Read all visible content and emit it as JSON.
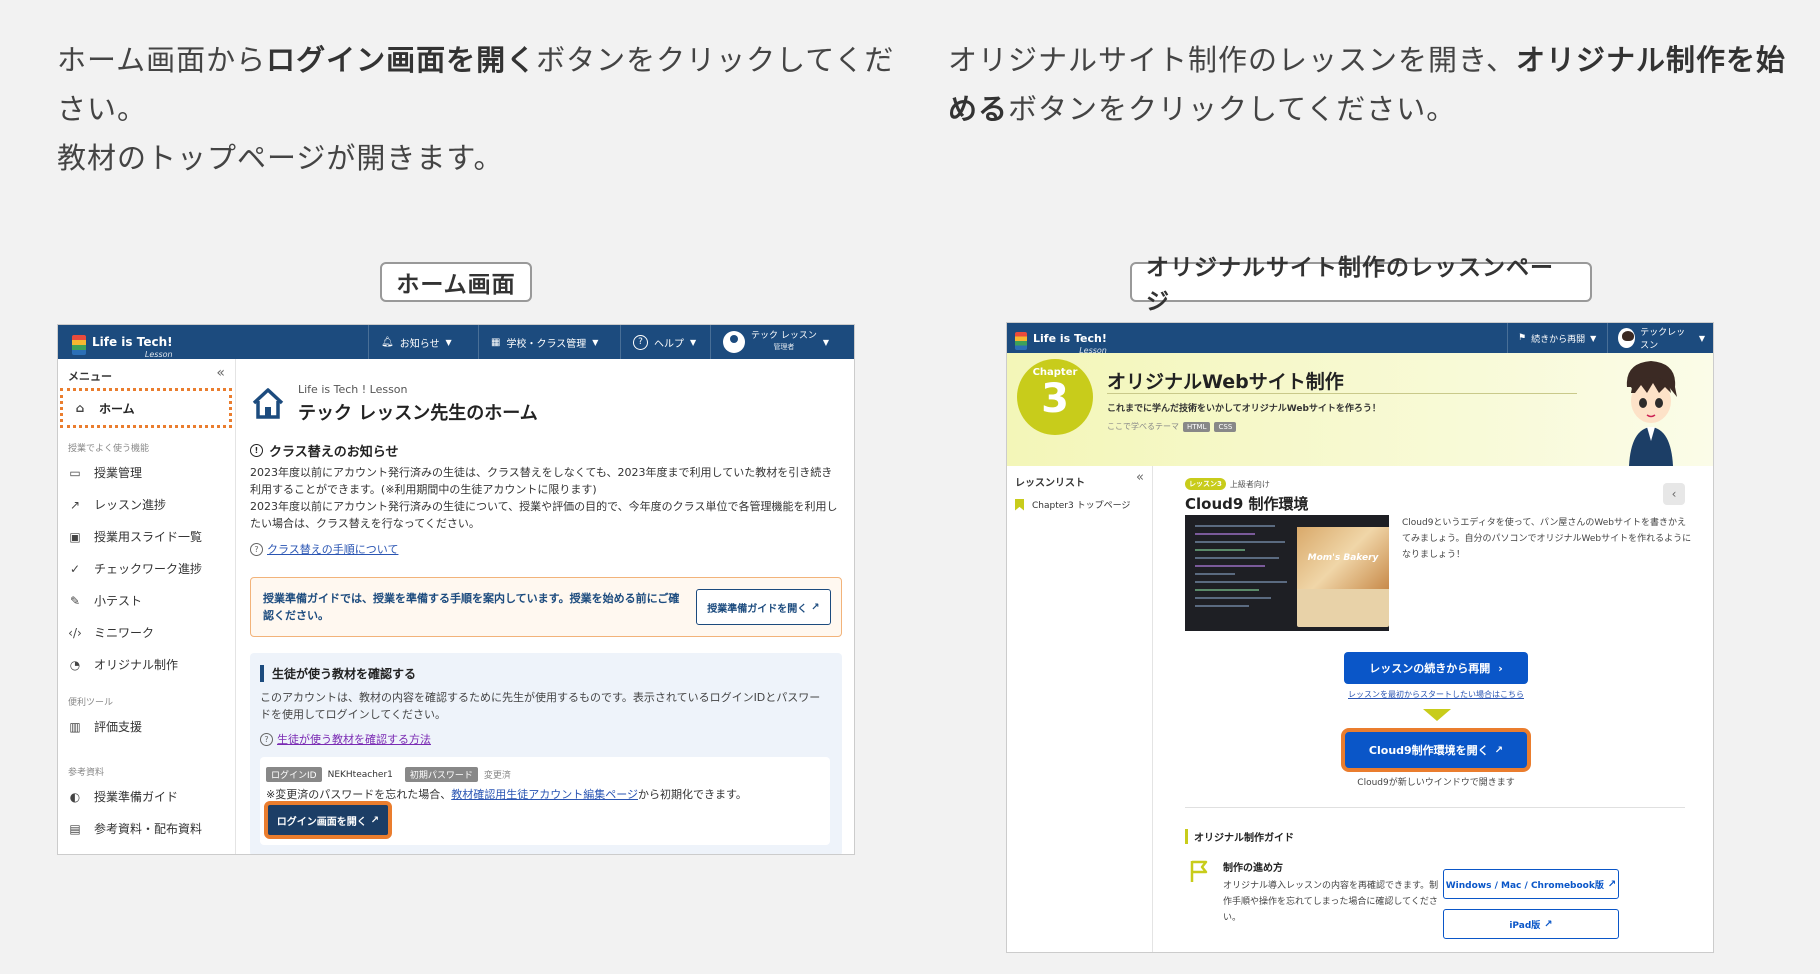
{
  "instructions": {
    "left": {
      "p1_pre": "ホーム画面から",
      "p1_bold": "ログイン画面を開く",
      "p1_post": "ボタンをクリックしてください。",
      "p2": "教材のトップページが開きます。"
    },
    "right": {
      "pre": "オリジナルサイト制作のレッスンを開き、",
      "bold": "オリジナル制作を始める",
      "post": "ボタンをクリックしてください。"
    }
  },
  "captions": {
    "left": "ホーム画面",
    "right": "オリジナルサイト制作のレッスンページ"
  },
  "colors": {
    "navy": "#1c4b7e",
    "orange_highlight": "#ea7d2e",
    "blue_button": "#0a56c8",
    "chapter_green": "#c8cc1b"
  },
  "home_screen": {
    "logo": {
      "text": "Life is Tech!",
      "sub": "Lesson"
    },
    "topbar": {
      "notifications": "お知らせ",
      "school_class": "学校・クラス管理",
      "help": "ヘルプ",
      "user_name": "テック レッスン",
      "user_role": "管理者"
    },
    "sidebar": {
      "menu_label": "メニュー",
      "home": "ホーム",
      "section_frequent": "授業でよく使う機能",
      "items_frequent": [
        {
          "label": "授業管理",
          "icon": "presentation-icon"
        },
        {
          "label": "レッスン進捗",
          "icon": "trend-icon"
        },
        {
          "label": "授業用スライド一覧",
          "icon": "monitor-icon"
        },
        {
          "label": "チェックワーク進捗",
          "icon": "check-circle-icon"
        },
        {
          "label": "小テスト",
          "icon": "pen-icon"
        },
        {
          "label": "ミニワーク",
          "icon": "code-icon"
        },
        {
          "label": "オリジナル制作",
          "icon": "palette-icon"
        }
      ],
      "section_tools": "便利ツール",
      "items_tools": [
        {
          "label": "評価支援",
          "icon": "chart-icon"
        }
      ],
      "section_refs": "参考資料",
      "items_refs": [
        {
          "label": "授業準備ガイド",
          "icon": "shield-icon"
        },
        {
          "label": "参考資料・配布資料",
          "icon": "document-icon"
        }
      ]
    },
    "main": {
      "subtitle": "Life is Tech ! Lesson",
      "title": "テック レッスン先生のホーム",
      "notice_title": "クラス替えのお知らせ",
      "notice_body_1": "2023年度以前にアカウント発行済みの生徒は、クラス替えをしなくても、2023年度まで利用していた教材を引き続き利用することができます。(※利用期間中の生徒アカウントに限ります)",
      "notice_body_2": "2023年度以前にアカウント発行済みの生徒について、授業や評価の目的で、今年度のクラス単位で各管理機能を利用したい場合は、クラス替えを行なってください。",
      "notice_link": "クラス替えの手順について",
      "guide_text": "授業準備ガイドでは、授業を準備する手順を案内しています。授業を始める前にご確認ください。",
      "guide_button": "授業準備ガイドを開く",
      "student_title": "生徒が使う教材を確認する",
      "student_body": "このアカウントは、教材の内容を確認するために先生が使用するものです。表示されているログインIDとパスワードを使用してログインしてください。",
      "student_link": "生徒が使う教材を確認する方法",
      "login_id_label": "ログインID",
      "login_id": "NEKHteacher1",
      "password_label": "初期パスワード",
      "password_value": "変更済",
      "reset_note_pre": "※変更済のパスワードを忘れた場合、",
      "reset_note_link": "教材確認用生徒アカウント編集ページ",
      "reset_note_post": "から初期化できます。",
      "login_button": "ログイン画面を開く"
    }
  },
  "lesson_screen": {
    "logo": {
      "text": "Life is Tech!",
      "sub": "Lesson"
    },
    "topbar": {
      "resume": "続きから再開",
      "user_name": "テックレッスン"
    },
    "banner": {
      "chapter_label": "Chapter",
      "chapter_number": "3",
      "title": "オリジナルWebサイト制作",
      "description": "これまでに学んだ技術をいかしてオリジナルWebサイトを作ろう！",
      "theme_label": "ここで学べるテーマ",
      "tags": [
        "HTML",
        "CSS"
      ]
    },
    "sidebar": {
      "label": "レッスンリスト",
      "item": "Chapter3 トップページ"
    },
    "lesson": {
      "badge": "レッスン3",
      "level": "上級者向け",
      "title": "Cloud9 制作環境",
      "thumb_text": "Mom's Bakery",
      "description": "Cloud9というエディタを使って、パン屋さんのWebサイトを書きかえてみましょう。自分のパソコンでオリジナルWebサイトを作れるようになりましょう！",
      "resume_button": "レッスンの続きから再開",
      "restart_link": "レッスンを最初からスタートしたい場合はこちら",
      "cloud9_button": "Cloud9制作環境を開く",
      "cloud9_note": "Cloud9が新しいウインドウで開きます"
    },
    "guide": {
      "heading": "オリジナル制作ガイド",
      "sub": "制作の進め方",
      "desc": "オリジナル導入レッスンの内容を再確認できます。制作手順や操作を忘れてしまった場合に確認してください。",
      "btn_pc": "Windows / Mac / Chromebook版",
      "btn_ipad": "iPad版"
    }
  }
}
